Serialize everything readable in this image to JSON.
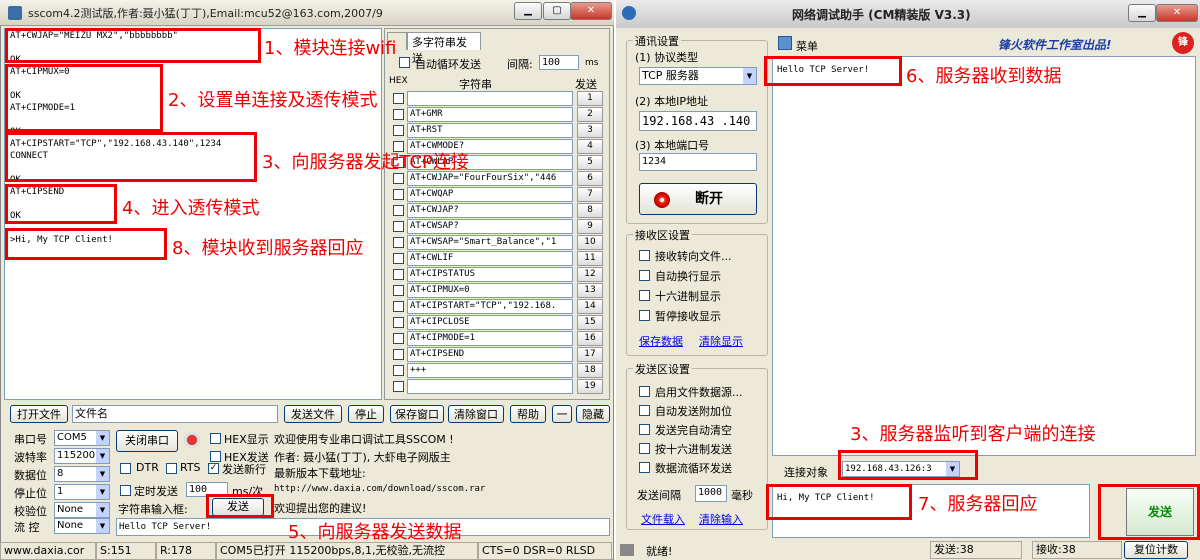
{
  "left_window": {
    "title": "sscom4.2测试版,作者:聂小猛(丁丁),Email:mcu52@163.com,2007/9",
    "terminal_lines": [
      "AT+CWJAP=\"MEIZU MX2\",\"bbbbbbbb\"",
      "OK",
      "AT+CIPMUX=0",
      "OK",
      "AT+CIPMODE=1",
      "OK",
      "AT+CIPSTART=\"TCP\",\"192.168.43.140\",1234",
      "CONNECT",
      "OK",
      "AT+CIPSEND",
      "OK",
      ">Hi, My TCP Client!"
    ],
    "multi_string_tab": "多字符串发送",
    "auto_loop_label": "自动循环发送",
    "interval_label": "间隔:",
    "interval_value": "100",
    "interval_unit": "ms",
    "col_hex": "HEX",
    "col_string": "字符串",
    "col_send": "发送",
    "commands": [
      {
        "text": "",
        "num": "1"
      },
      {
        "text": "AT+GMR",
        "num": "2"
      },
      {
        "text": "AT+RST",
        "num": "3"
      },
      {
        "text": "AT+CWMODE?",
        "num": "4"
      },
      {
        "text": "AT+CWLAP",
        "num": "5"
      },
      {
        "text": "AT+CWJAP=\"FourFourSix\",\"446",
        "num": "6"
      },
      {
        "text": "AT+CWQAP",
        "num": "7"
      },
      {
        "text": "AT+CWJAP?",
        "num": "8"
      },
      {
        "text": "AT+CWSAP?",
        "num": "9"
      },
      {
        "text": "AT+CWSAP=\"Smart_Balance\",\"1",
        "num": "10"
      },
      {
        "text": "AT+CWLIF",
        "num": "11"
      },
      {
        "text": "AT+CIPSTATUS",
        "num": "12"
      },
      {
        "text": "AT+CIPMUX=0",
        "num": "13"
      },
      {
        "text": "AT+CIPSTART=\"TCP\",\"192.168.",
        "num": "14"
      },
      {
        "text": "AT+CIPCLOSE",
        "num": "15"
      },
      {
        "text": "AT+CIPMODE=1",
        "num": "16"
      },
      {
        "text": "AT+CIPSEND",
        "num": "17"
      },
      {
        "text": "+++",
        "num": "18"
      },
      {
        "text": "",
        "num": "19"
      }
    ],
    "open_file": "打开文件",
    "file_name": "文件名",
    "send_file": "发送文件",
    "stop": "停止",
    "save_window": "保存窗口",
    "clear_window": "清除窗口",
    "help": "帮助",
    "dash": "一",
    "hide": "隐藏",
    "port_label": "串口号",
    "port_value": "COM5",
    "close_port": "关闭串口",
    "hex_display": "HEX显示",
    "baud_label": "波特率",
    "baud_value": "115200",
    "hex_send": "HEX发送",
    "databits_label": "数据位",
    "databits_value": "8",
    "dtr": "DTR",
    "rts": "RTS",
    "send_newline": "发送新行",
    "stopbits_label": "停止位",
    "stopbits_value": "1",
    "timed_send": "定时发送",
    "timed_value": "100",
    "timed_unit": "ms/次",
    "parity_label": "校验位",
    "parity_value": "None",
    "string_input_label": "字符串输入框:",
    "send_button": "发送",
    "flow_label": "流 控",
    "flow_value": "None",
    "input_value": "Hello TCP Server!",
    "info_lines": [
      "欢迎使用专业串口调试工具SSCOM !",
      "作者: 聂小猛(丁丁), 大虾电子网版主",
      "最新版本下载地址:",
      "http://www.daxia.com/download/sscom.rar",
      "欢迎提出您的建议!"
    ],
    "status_url": "www.daxia.cor",
    "status_s": "S:151",
    "status_r": "R:178",
    "status_port": "COM5已打开  115200bps,8,1,无校验,无流控",
    "status_lines": "CTS=0 DSR=0 RLSD"
  },
  "right_window": {
    "title": "网络调试助手 (CM精装版 V3.3)",
    "brand": "锋火软件工作室出品!",
    "brand_icon": "锋",
    "comm_settings": "通讯设置",
    "protocol_label": "(1) 协议类型",
    "protocol_value": "TCP 服务器",
    "local_ip_label": "(2) 本地IP地址",
    "local_ip_value": "192.168.43 .140",
    "local_port_label": "(3) 本地端口号",
    "local_port_value": "1234",
    "disconnect": "断开",
    "recv_settings": "接收区设置",
    "recv_options": [
      "接收转向文件...",
      "自动换行显示",
      "十六进制显示",
      "暂停接收显示"
    ],
    "save_data": "保存数据",
    "clear_display": "清除显示",
    "send_settings": "发送区设置",
    "send_options": [
      "启用文件数据源...",
      "自动发送附加位",
      "发送完自动清空",
      "按十六进制发送",
      "数据流循环发送"
    ],
    "send_interval_label": "发送间隔",
    "send_interval_value": "1000",
    "send_interval_unit": "毫秒",
    "file_load": "文件载入",
    "clear_input": "清除输入",
    "menu_label": "菜单",
    "received_text": "Hello TCP Server!",
    "connection_label": "连接对象",
    "connection_value": "192.168.43.126:3",
    "send_text": "Hi, My TCP Client!",
    "send_button": "发送",
    "status_ready": "就绪!",
    "status_sent": "发送:38",
    "status_recv": "接收:38",
    "reset_count": "复位计数"
  },
  "annotations": [
    "1、模块连接wifi",
    "2、设置单连接及透传模式",
    "3、向服务器发起TCP连接",
    "4、进入透传模式",
    "8、模块收到服务器回应",
    "5、向服务器发送数据",
    "6、服务器收到数据",
    "3、服务器监听到客户端的连接",
    "7、服务器回应"
  ]
}
